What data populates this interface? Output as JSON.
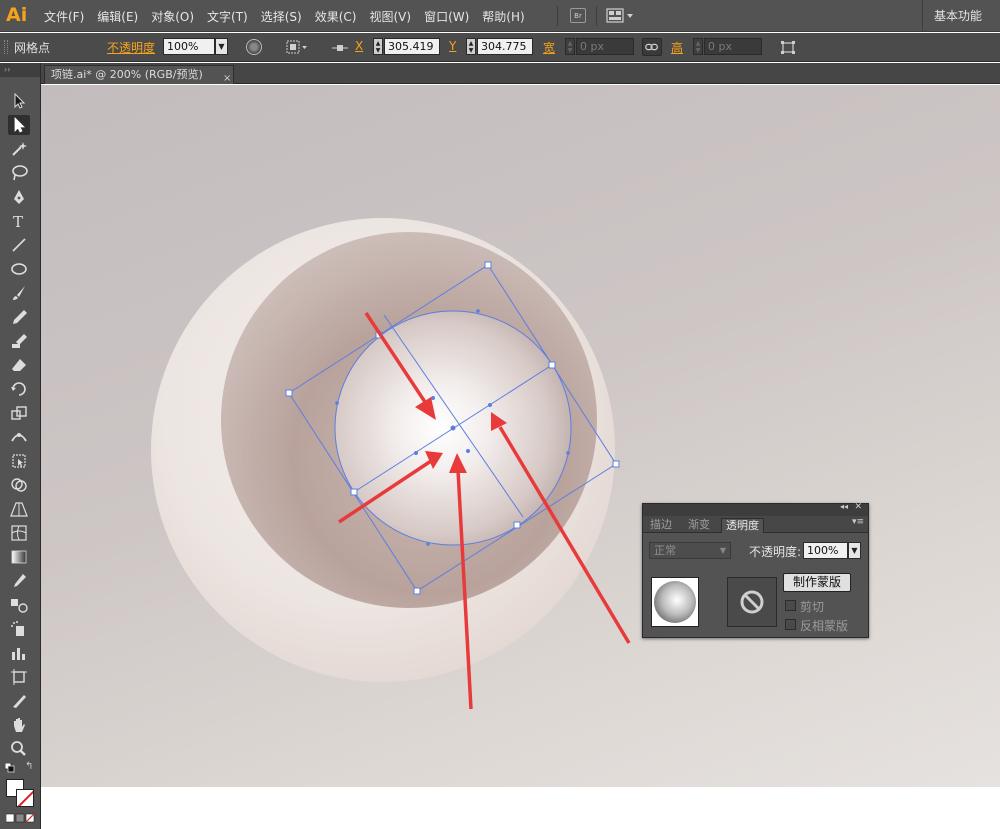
{
  "app": {
    "logo": "Ai"
  },
  "menu": [
    "文件(F)",
    "编辑(E)",
    "对象(O)",
    "文字(T)",
    "选择(S)",
    "效果(C)",
    "视图(V)",
    "窗口(W)",
    "帮助(H)"
  ],
  "menubar": {
    "bridge_label": "Br",
    "workspace": "基本功能"
  },
  "control_bar": {
    "selection_label": "网格点",
    "opacity_label": "不透明度",
    "opacity_value": "100%",
    "x_label": "X",
    "x_value": "305.419",
    "y_label": "Y",
    "y_value": "304.775",
    "w_label": "宽",
    "w_value": "0 px",
    "h_label": "高",
    "h_value": "0 px"
  },
  "document_tab": {
    "title": "项链.ai* @ 200% (RGB/预览)",
    "close": "×"
  },
  "toolbox_header": "››",
  "transparency_panel": {
    "tabs": [
      "描边",
      "渐变",
      "透明度"
    ],
    "active_tab": "透明度",
    "blend_mode": "正常",
    "opacity_label": "不透明度:",
    "opacity_value": "100%",
    "make_mask_button": "制作蒙版",
    "clip_label": "剪切",
    "invert_mask_label": "反相蒙版"
  },
  "colors": {
    "accent": "#f7a21b",
    "selection": "#4a6fd8",
    "arrow": "#e83a3a"
  }
}
